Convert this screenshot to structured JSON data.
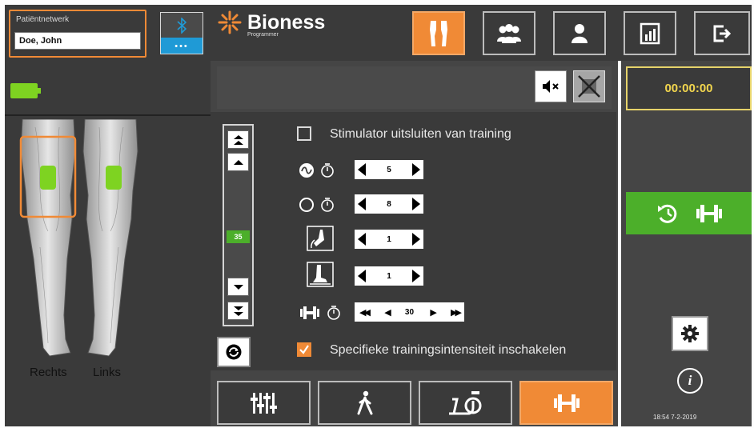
{
  "colors": {
    "accent": "#f08a36",
    "green": "#4caf2a",
    "panel": "#3a3a3a",
    "timer_text": "#f1d54e"
  },
  "patient": {
    "label": "Patiëntnetwerk",
    "name": "Doe, John"
  },
  "bluetooth": {
    "icon": "bluetooth-icon",
    "dots": "•••"
  },
  "battery": {
    "icon": "battery-icon",
    "level": 1.0
  },
  "legs": {
    "right_label": "Rechts",
    "left_label": "Links"
  },
  "brand": {
    "name": "Bioness",
    "sub": "Programmer"
  },
  "header": {
    "buttons": [
      {
        "icon": "legs-icon",
        "active": true
      },
      {
        "icon": "group-icon",
        "active": false
      },
      {
        "icon": "user-icon",
        "active": false
      },
      {
        "icon": "report-icon",
        "active": false
      },
      {
        "icon": "logout-icon",
        "active": false
      }
    ]
  },
  "alert": {
    "mute_icon": "mute-icon",
    "no_alert_icon": "no-alert-icon"
  },
  "slider": {
    "value": "35",
    "buttons": [
      "double-up-icon",
      "up-icon",
      "down-icon",
      "double-down-icon"
    ]
  },
  "settings": {
    "exclude_label": "Stimulator uitsluiten van training",
    "exclude_checked": false,
    "rows": [
      {
        "icon": "wave-timer-icon",
        "value": "5"
      },
      {
        "icon": "circle-timer-icon",
        "value": "8"
      },
      {
        "icon": "foot-lift-icon",
        "value": "1"
      },
      {
        "icon": "foot-down-icon",
        "value": "1"
      },
      {
        "icon": "dumbbell-timer-icon",
        "value": "30"
      }
    ],
    "specific_label": "Specifieke trainingsintensiteit inschakelen",
    "specific_checked": true
  },
  "bottom_nav": [
    {
      "icon": "sliders-icon",
      "active": false
    },
    {
      "icon": "walk-icon",
      "active": false
    },
    {
      "icon": "bike-icon",
      "active": false
    },
    {
      "icon": "dumbbell-icon",
      "active": true
    }
  ],
  "timer": "00:00:00",
  "train_button": {
    "icons": [
      "history-icon",
      "dumbbell-icon"
    ]
  },
  "datetime": "18:54 7-2-2019"
}
